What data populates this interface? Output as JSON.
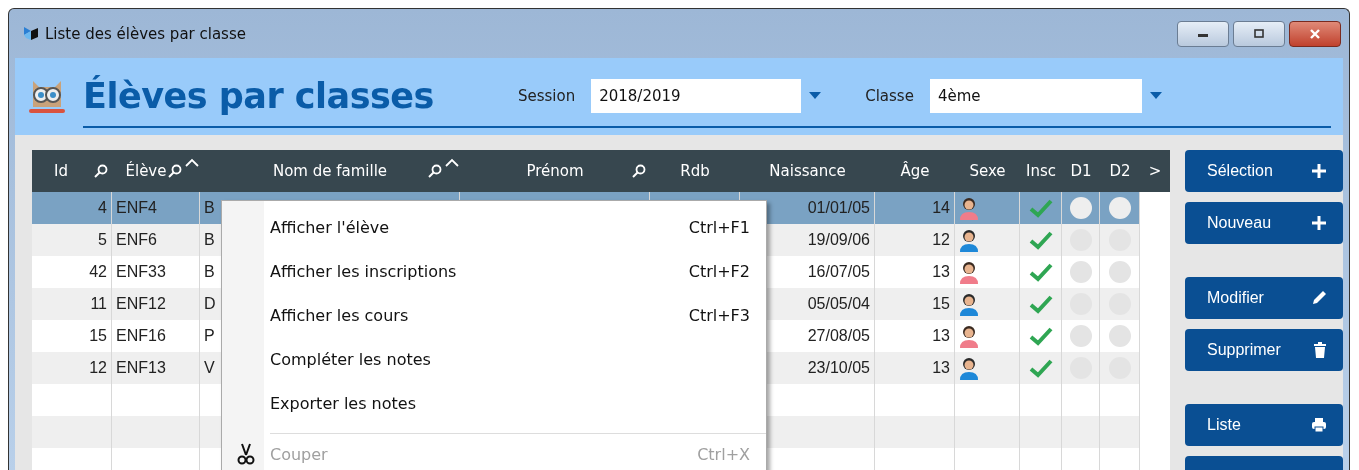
{
  "window": {
    "title": "Liste des élèves par classe"
  },
  "header": {
    "title": "Élèves par classes",
    "session_label": "Session",
    "session_value": "2018/2019",
    "classe_label": "Classe",
    "classe_value": "4ème"
  },
  "table": {
    "columns": [
      {
        "label": "Id",
        "filter": true,
        "sorted": false
      },
      {
        "label": "Élève",
        "filter": true,
        "sorted": true
      },
      {
        "label": "Nom de famille",
        "filter": true,
        "sorted": true
      },
      {
        "label": "Prénom",
        "filter": true,
        "sorted": false
      },
      {
        "label": "Rdb",
        "filter": false,
        "sorted": false
      },
      {
        "label": "Naissance",
        "filter": false,
        "sorted": false
      },
      {
        "label": "Âge",
        "filter": false,
        "sorted": false
      },
      {
        "label": "Sexe",
        "filter": false,
        "sorted": false
      },
      {
        "label": "Insc",
        "filter": false,
        "sorted": false
      },
      {
        "label": "D1",
        "filter": false,
        "sorted": false
      },
      {
        "label": "D2",
        "filter": false,
        "sorted": false
      },
      {
        "label": ">",
        "filter": false,
        "sorted": false
      }
    ],
    "rows": [
      {
        "id": "4",
        "eleve": "ENF4",
        "nom": "B",
        "naissance": "01/01/05",
        "age": "14",
        "female": true,
        "insc": true,
        "selected": true
      },
      {
        "id": "5",
        "eleve": "ENF6",
        "nom": "B",
        "naissance": "19/09/06",
        "age": "12",
        "female": false,
        "insc": true,
        "selected": false
      },
      {
        "id": "42",
        "eleve": "ENF33",
        "nom": "B",
        "naissance": "16/07/05",
        "age": "13",
        "female": true,
        "insc": true,
        "selected": false
      },
      {
        "id": "11",
        "eleve": "ENF12",
        "nom": "D",
        "naissance": "05/05/04",
        "age": "15",
        "female": false,
        "insc": true,
        "selected": false
      },
      {
        "id": "15",
        "eleve": "ENF16",
        "nom": "P",
        "naissance": "27/08/05",
        "age": "13",
        "female": true,
        "insc": true,
        "selected": false
      },
      {
        "id": "12",
        "eleve": "ENF13",
        "nom": "V",
        "naissance": "23/10/05",
        "age": "13",
        "female": false,
        "insc": true,
        "selected": false
      }
    ]
  },
  "buttons": [
    {
      "label": "Sélection",
      "kind": "add"
    },
    {
      "label": "Nouveau",
      "kind": "add"
    },
    {
      "label": "Modifier",
      "kind": "edit"
    },
    {
      "label": "Supprimer",
      "kind": "delete"
    },
    {
      "label": "Liste",
      "kind": "print"
    }
  ],
  "context_menu": [
    {
      "kind": "command",
      "label": "Afficher l'élève",
      "shortcut": "Ctrl+F1",
      "disabled": false
    },
    {
      "kind": "command",
      "label": "Afficher les inscriptions",
      "shortcut": "Ctrl+F2",
      "disabled": false
    },
    {
      "kind": "command",
      "label": "Afficher les cours",
      "shortcut": "Ctrl+F3",
      "disabled": false
    },
    {
      "kind": "command",
      "label": "Compléter les notes",
      "disabled": false
    },
    {
      "kind": "command",
      "label": "Exporter les notes",
      "disabled": false
    },
    {
      "kind": "separator"
    },
    {
      "kind": "cut",
      "label": "Couper",
      "shortcut": "Ctrl+X",
      "disabled": true
    }
  ]
}
